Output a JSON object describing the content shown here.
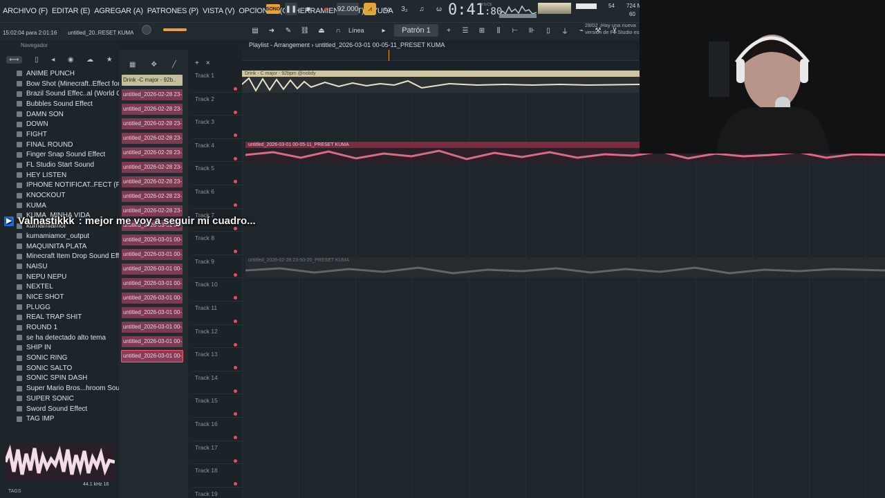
{
  "menu": [
    "ARCHIVO (F)",
    "EDITAR (E)",
    "AGREGAR (A)",
    "PATRONES (P)",
    "VISTA (V)",
    "OPCIONES (O)",
    "HERRAMIENTAS (T)",
    "AYUDA"
  ],
  "transport": {
    "song_label": "SONG",
    "tempo": "92.000",
    "time_main": "0:41",
    "time_sub": "80",
    "time_unit": "M:S:CS"
  },
  "meters": {
    "cpu": "54",
    "ram": "724 M",
    "voices": "60"
  },
  "status": {
    "time": "15:02:04 para 2:01:16",
    "project": "untitled_20..RESET KUMA"
  },
  "toolbar": {
    "snap": "Línea",
    "pattern": "Patrón 1"
  },
  "news": {
    "date": "28/02",
    "line1": "¡Hay una nueva",
    "line2": "versión de FL Studio está"
  },
  "browser": {
    "title": "Navegador",
    "items": [
      "ANIME PUNCH",
      "Bow Shot (Minecraft..Effect for editing",
      "Brazil Sound Effec..al (World Cup 2002)",
      "Bubbles Sound Effect",
      "DAMN SON",
      "DOWN",
      "FIGHT",
      "FINAL ROUND",
      "Finger Snap Sound Effect",
      "FL Studio Start Sound",
      "HEY LISTEN",
      "IPHONE NOTIFICAT..FECT (PINGDING)",
      "KNOCKOUT",
      "KUMA",
      "KUMA_MINHA VIDA",
      "kumamiamor",
      "kumamiamor_output",
      "MAQUINITA PLATA",
      "Minecraft Item Drop Sound Effect!",
      "NAISU",
      "NEPU NEPU",
      "NEXTEL",
      "NICE SHOT",
      "PLUGG",
      "REAL TRAP SHIT",
      "ROUND 1",
      "se ha detectado alto tema",
      "SHIP IN",
      "SONIC RING",
      "SONIC SALTO",
      "SONIC SPIN DASH",
      "Super Mario Bros...hroom Sound Effect",
      "SUPER SONIC",
      "Sword Sound Effect",
      "TAG IMP"
    ],
    "sample_rate": "44.1 kHz 16",
    "tags_label": "TAGS"
  },
  "patterns": [
    "Drink -C major - 92b..",
    "untitled_2026-02-28 23-..",
    "untitled_2026-02-28 23-..",
    "untitled_2026-02-28 23-..",
    "untitled_2026-02-28 23-..",
    "untitled_2026-02-28 23-..",
    "untitled_2026-02-28 23-..",
    "untitled_2026-02-28 23-..",
    "untitled_2026-02-28 23-..",
    "untitled_2026-02-28 23-..",
    "untitled_2026-03-01 00-..",
    "untitled_2026-03-01 00-..",
    "untitled_2026-03-01 00-..",
    "untitled_2026-03-01 00-..",
    "untitled_2026-03-01 00-..",
    "untitled_2026-03-01 00-..",
    "untitled_2026-03-01 00-..",
    "untitled_2026-03-01 00-..",
    "untitled_2026-03-01 00-..",
    "untitled_2026-03-01 00-.."
  ],
  "playlist": {
    "title": "Playlist - Arrangement",
    "path": "untitled_2026-03-01 00-05-11_PRESET KUMA",
    "tracks": [
      "Track 1",
      "Track 2",
      "Track 3",
      "Track 4",
      "Track 5",
      "Track 6",
      "Track 7",
      "Track 8",
      "Track 9",
      "Track 10",
      "Track 11",
      "Track 12",
      "Track 13",
      "Track 14",
      "Track 15",
      "Track 16",
      "Track 17",
      "Track 18",
      "Track 19"
    ],
    "clips": [
      "Drink - C major - 92bpm @nobdy",
      "untitled_2026-03-01 00-05-11_PRESET KUMA",
      "untitled_2026-02-28 23-50-20_PRESET KUMA"
    ]
  },
  "chat": {
    "user": "Valnastikkk",
    "message": ": mejor me voy a seguir mí cuadro..."
  }
}
